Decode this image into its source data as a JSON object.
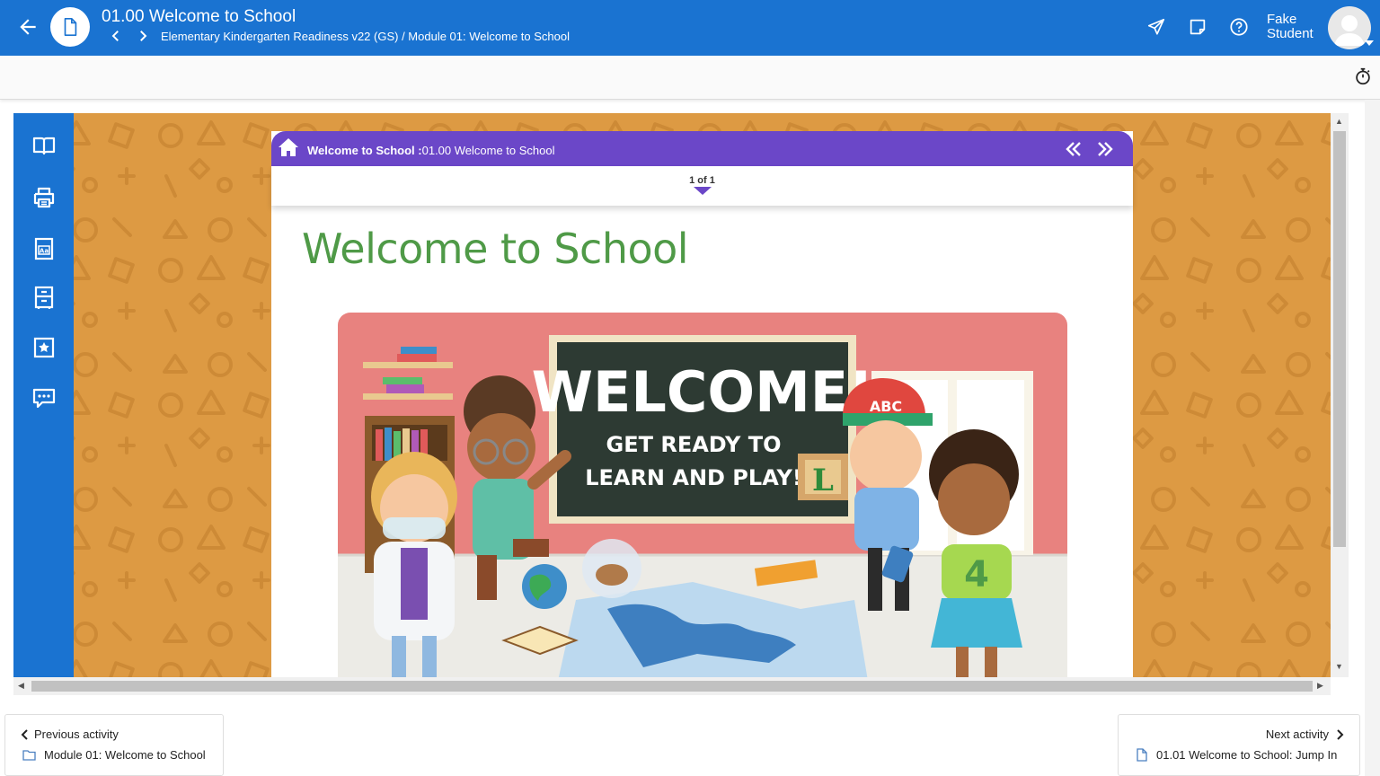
{
  "header": {
    "title": "01.00 Welcome to School",
    "breadcrumb": "Elementary Kindergarten Readiness v22 (GS) / Module 01: Welcome to School",
    "user_first": "Fake",
    "user_last": "Student",
    "icons": [
      "back-arrow-icon",
      "document-icon",
      "chevron-left-icon",
      "chevron-right-icon",
      "send-icon",
      "notes-icon",
      "help-icon",
      "avatar",
      "stopwatch-icon"
    ]
  },
  "tools": [
    "book-icon",
    "print-icon",
    "glossary-icon",
    "cabinet-icon",
    "bookmark-star-icon",
    "chat-icon"
  ],
  "lesson": {
    "course_label": "Welcome to School :",
    "page_label": "01.00 Welcome to School",
    "pager": "1 of 1",
    "heading": "Welcome to School",
    "chalkboard_title": "WELCOME!",
    "chalkboard_line1": "GET READY TO",
    "chalkboard_line2": "LEARN AND PLAY!",
    "cap_text": "ABC",
    "block_letter": "L",
    "shirt_number": "4"
  },
  "nav": {
    "prev_label": "Previous activity",
    "prev_value": "Module 01: Welcome to School",
    "next_label": "Next activity",
    "next_value": "01.01 Welcome to School: Jump In"
  },
  "colors": {
    "primary": "#1a73d1",
    "lesson_header": "#6b47c8",
    "heading_green": "#4f9a47",
    "frame_orange": "#dd9a43"
  }
}
